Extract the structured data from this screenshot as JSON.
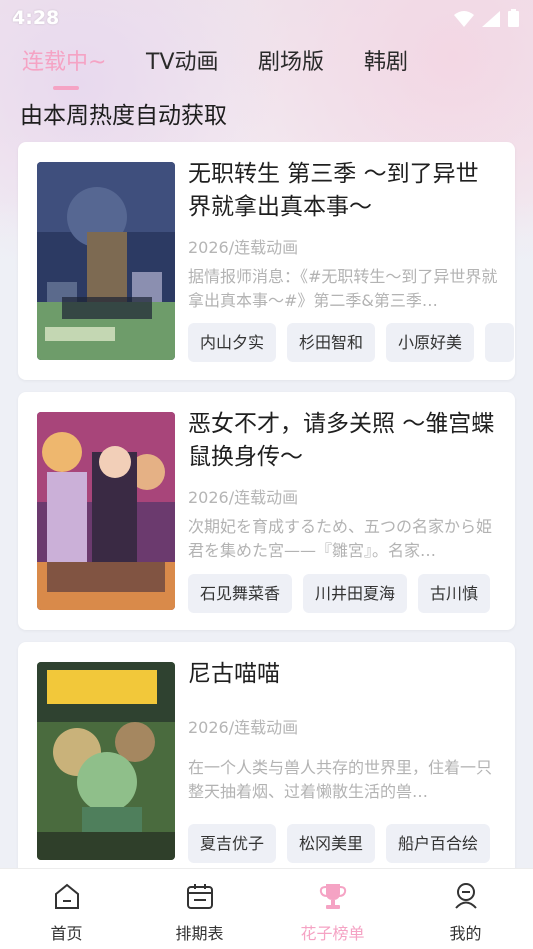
{
  "status_bar": {
    "time": "4:28"
  },
  "tabs": [
    {
      "label": "连载中~",
      "active": true
    },
    {
      "label": "TV动画",
      "active": false
    },
    {
      "label": "剧场版",
      "active": false
    },
    {
      "label": "韩剧",
      "active": false
    }
  ],
  "subtitle": "由本周热度自动获取",
  "cards": [
    {
      "title": "无职转生 第三季 ～到了异世界就拿出真本事～",
      "year": "2026/连载动画",
      "desc": "据情报师消息：《#无职转生～到了异世界就拿出真本事～#》第二季&第三季…",
      "tags": [
        "内山夕实",
        "杉田智和",
        "小原好美"
      ]
    },
    {
      "title": "恶女不才，请多关照 ～雏宫蝶鼠换身传～",
      "year": "2026/连载动画",
      "desc": "次期妃を育成するため、五つの名家から姫君を集めた宮——『雛宮』。名家…",
      "tags": [
        "石见舞菜香",
        "川井田夏海",
        "古川慎"
      ]
    },
    {
      "title": "尼古喵喵",
      "year": "2026/连载动画",
      "desc": "在一个人类与兽人共存的世界里，住着一只整天抽着烟、过着懒散生活的兽…",
      "tags": [
        "夏吉优子",
        "松冈美里",
        "船户百合绘"
      ]
    }
  ],
  "nav": [
    {
      "label": "首页",
      "icon": "home-icon",
      "active": false
    },
    {
      "label": "排期表",
      "icon": "calendar-icon",
      "active": false
    },
    {
      "label": "花子榜单",
      "icon": "trophy-icon",
      "active": true
    },
    {
      "label": "我的",
      "icon": "user-icon",
      "active": false
    }
  ],
  "colors": {
    "accent": "#f5a3c4",
    "background": "#eef0f6"
  }
}
